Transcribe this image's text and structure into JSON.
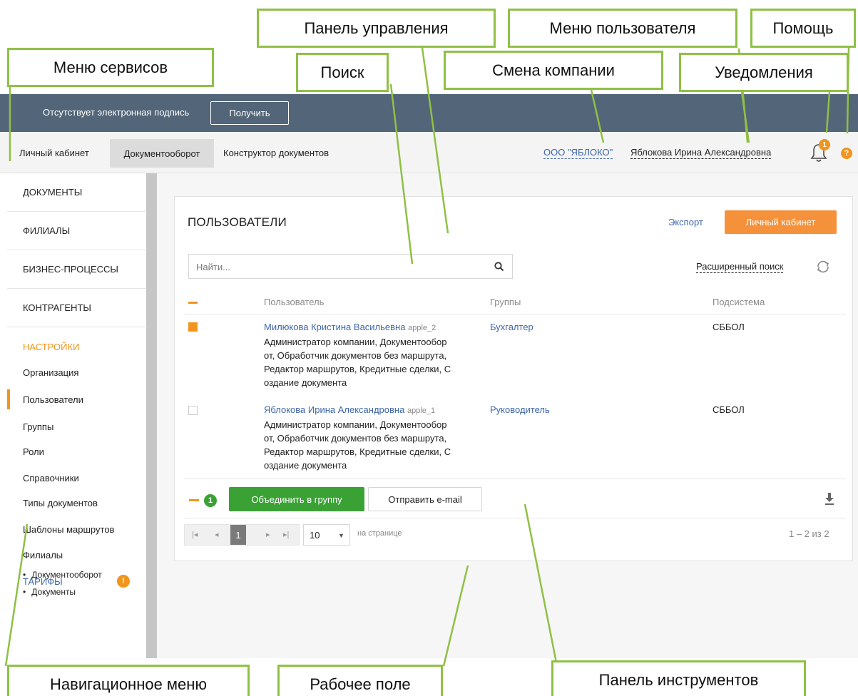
{
  "topbar": {
    "message": "Отсутствует электронная подпись",
    "get_button": "Получить"
  },
  "services": {
    "items": [
      "Личный кабинет",
      "Документооборот",
      "Конструктор документов"
    ],
    "active": "Документооборот"
  },
  "header": {
    "company": "ООО \"ЯБЛОКО\"",
    "user": "Яблокова Ирина Александровна",
    "notifications_count": "1",
    "help_icon": "?"
  },
  "sidebar": {
    "sections": [
      "ДОКУМЕНТЫ",
      "ФИЛИАЛЫ",
      "БИЗНЕС-ПРОЦЕССЫ",
      "КОНТРАГЕНТЫ"
    ],
    "settings_title": "НАСТРОЙКИ",
    "settings_items": [
      "Организация",
      "Пользователи",
      "Группы",
      "Роли",
      "Справочники",
      "Типы документов",
      "Шаблоны маршрутов",
      "Филиалы"
    ],
    "active_item": "Пользователи",
    "sub_items": [
      "Документооборот",
      "Документы"
    ],
    "tariffs": "ТАРИФЫ",
    "tariffs_badge": "!"
  },
  "panel": {
    "title": "ПОЛЬЗОВАТЕЛИ",
    "export_label": "Экспорт",
    "cabinet_button": "Личный кабинет",
    "search_placeholder": "Найти...",
    "advanced_search": "Расширенный поиск",
    "columns": [
      "Пользователь",
      "Группы",
      "Подсистема"
    ],
    "rows": [
      {
        "checked": true,
        "name": "Милюкова Кристина Васильевна",
        "login": "apple_2",
        "roles": [
          "Администратор компании, Документообор",
          "от, Обработчик документов без маршрута,",
          "Редактор маршрутов, Кредитные сделки, С",
          "оздание документа"
        ],
        "group": "Бухгалтер",
        "subsystem": "СББОЛ"
      },
      {
        "checked": false,
        "name": "Яблокова Ирина Александровна",
        "login": "apple_1",
        "roles": [
          "Администратор компании, Документообор",
          "от, Обработчик документов без маршрута,",
          "Редактор маршрутов, Кредитные сделки, С",
          "оздание документа"
        ],
        "group": "Руководитель",
        "subsystem": "СББОЛ"
      }
    ],
    "toolbar": {
      "selected_count": "1",
      "merge_button": "Объединить в группу",
      "email_button": "Отправить e-mail"
    },
    "pager": {
      "current_page": "1",
      "per_page": "10",
      "per_page_label": "на странице",
      "range": "1 – 2 из 2"
    }
  },
  "callouts": {
    "services_menu": "Меню сервисов",
    "control_panel": "Панель управления",
    "search": "Поиск",
    "user_menu": "Меню пользователя",
    "company_switch": "Смена компании",
    "notifications": "Уведомления",
    "help": "Помощь",
    "nav_menu": "Навигационное меню",
    "workspace": "Рабочее поле",
    "toolbar": "Панель инструментов"
  },
  "colors": {
    "topbar": "#536578",
    "accent_orange": "#f0951d",
    "accent_green": "#3aa235",
    "link_blue": "#3e66a8",
    "callout_border": "#8fc045"
  }
}
